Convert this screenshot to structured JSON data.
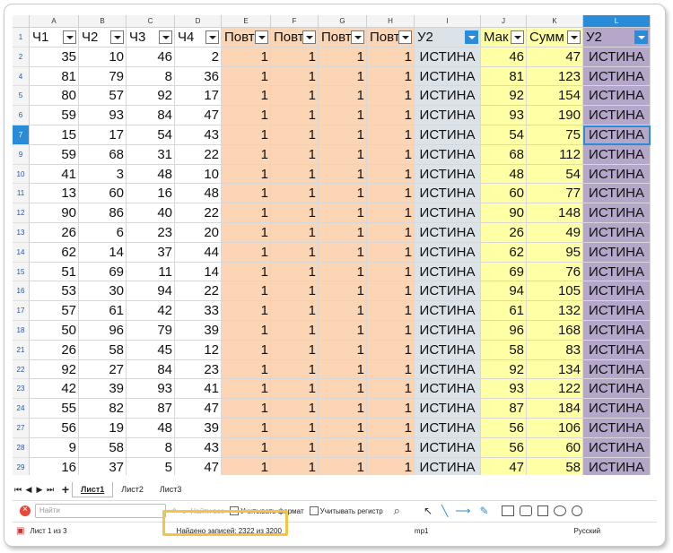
{
  "columns": [
    "A",
    "B",
    "C",
    "D",
    "E",
    "F",
    "G",
    "H",
    "I",
    "J",
    "K",
    "L"
  ],
  "selected_column": "L",
  "header_row": {
    "row_num": "1",
    "cells": [
      "Ч1",
      "Ч2",
      "Ч3",
      "Ч4",
      "Повт",
      "Повт",
      "Повт",
      "Повт",
      "У2",
      "Мак",
      "Сумм",
      "У2"
    ]
  },
  "rows": [
    {
      "num": "2",
      "cells": [
        "35",
        "10",
        "46",
        "2",
        "1",
        "1",
        "1",
        "1",
        "ИСТИНА",
        "46",
        "47",
        "ИСТИНА"
      ]
    },
    {
      "num": "4",
      "cells": [
        "81",
        "79",
        "8",
        "36",
        "1",
        "1",
        "1",
        "1",
        "ИСТИНА",
        "81",
        "123",
        "ИСТИНА"
      ]
    },
    {
      "num": "5",
      "cells": [
        "80",
        "57",
        "92",
        "17",
        "1",
        "1",
        "1",
        "1",
        "ИСТИНА",
        "92",
        "154",
        "ИСТИНА"
      ]
    },
    {
      "num": "6",
      "cells": [
        "59",
        "93",
        "84",
        "47",
        "1",
        "1",
        "1",
        "1",
        "ИСТИНА",
        "93",
        "190",
        "ИСТИНА"
      ]
    },
    {
      "num": "7",
      "cells": [
        "15",
        "17",
        "54",
        "43",
        "1",
        "1",
        "1",
        "1",
        "ИСТИНА",
        "54",
        "75",
        "ИСТИНА"
      ]
    },
    {
      "num": "9",
      "cells": [
        "59",
        "68",
        "31",
        "22",
        "1",
        "1",
        "1",
        "1",
        "ИСТИНА",
        "68",
        "112",
        "ИСТИНА"
      ]
    },
    {
      "num": "10",
      "cells": [
        "41",
        "3",
        "48",
        "10",
        "1",
        "1",
        "1",
        "1",
        "ИСТИНА",
        "48",
        "54",
        "ИСТИНА"
      ]
    },
    {
      "num": "11",
      "cells": [
        "13",
        "60",
        "16",
        "48",
        "1",
        "1",
        "1",
        "1",
        "ИСТИНА",
        "60",
        "77",
        "ИСТИНА"
      ]
    },
    {
      "num": "12",
      "cells": [
        "90",
        "86",
        "40",
        "22",
        "1",
        "1",
        "1",
        "1",
        "ИСТИНА",
        "90",
        "148",
        "ИСТИНА"
      ]
    },
    {
      "num": "13",
      "cells": [
        "26",
        "6",
        "23",
        "20",
        "1",
        "1",
        "1",
        "1",
        "ИСТИНА",
        "26",
        "49",
        "ИСТИНА"
      ]
    },
    {
      "num": "14",
      "cells": [
        "62",
        "14",
        "37",
        "44",
        "1",
        "1",
        "1",
        "1",
        "ИСТИНА",
        "62",
        "95",
        "ИСТИНА"
      ]
    },
    {
      "num": "15",
      "cells": [
        "51",
        "69",
        "11",
        "14",
        "1",
        "1",
        "1",
        "1",
        "ИСТИНА",
        "69",
        "76",
        "ИСТИНА"
      ]
    },
    {
      "num": "16",
      "cells": [
        "53",
        "30",
        "94",
        "22",
        "1",
        "1",
        "1",
        "1",
        "ИСТИНА",
        "94",
        "105",
        "ИСТИНА"
      ]
    },
    {
      "num": "17",
      "cells": [
        "57",
        "61",
        "42",
        "33",
        "1",
        "1",
        "1",
        "1",
        "ИСТИНА",
        "61",
        "132",
        "ИСТИНА"
      ]
    },
    {
      "num": "18",
      "cells": [
        "50",
        "96",
        "79",
        "39",
        "1",
        "1",
        "1",
        "1",
        "ИСТИНА",
        "96",
        "168",
        "ИСТИНА"
      ]
    },
    {
      "num": "21",
      "cells": [
        "26",
        "58",
        "45",
        "12",
        "1",
        "1",
        "1",
        "1",
        "ИСТИНА",
        "58",
        "83",
        "ИСТИНА"
      ]
    },
    {
      "num": "22",
      "cells": [
        "92",
        "27",
        "84",
        "23",
        "1",
        "1",
        "1",
        "1",
        "ИСТИНА",
        "92",
        "134",
        "ИСТИНА"
      ]
    },
    {
      "num": "23",
      "cells": [
        "42",
        "39",
        "93",
        "41",
        "1",
        "1",
        "1",
        "1",
        "ИСТИНА",
        "93",
        "122",
        "ИСТИНА"
      ]
    },
    {
      "num": "24",
      "cells": [
        "55",
        "82",
        "87",
        "47",
        "1",
        "1",
        "1",
        "1",
        "ИСТИНА",
        "87",
        "184",
        "ИСТИНА"
      ]
    },
    {
      "num": "27",
      "cells": [
        "56",
        "19",
        "48",
        "39",
        "1",
        "1",
        "1",
        "1",
        "ИСТИНА",
        "56",
        "106",
        "ИСТИНА"
      ]
    },
    {
      "num": "28",
      "cells": [
        "9",
        "58",
        "8",
        "43",
        "1",
        "1",
        "1",
        "1",
        "ИСТИНА",
        "56",
        "60",
        "ИСТИНА"
      ]
    },
    {
      "num": "29",
      "cells": [
        "16",
        "37",
        "5",
        "47",
        "1",
        "1",
        "1",
        "1",
        "ИСТИНА",
        "47",
        "58",
        "ИСТИНА"
      ]
    }
  ],
  "selected_row": "7",
  "sheet_tabs": [
    "Лист1",
    "Лист2",
    "Лист3"
  ],
  "active_sheet": "Лист1",
  "find": {
    "placeholder": "Найти",
    "find_all": "Найти все",
    "match_format": "Учитывать формат",
    "match_case": "Учитывать регистр"
  },
  "status": {
    "sheet": "Лист 1 из 3",
    "found": "Найдено записей: 2322 из 3200",
    "style": "mp1",
    "language": "Русский"
  },
  "colors": {
    "orange": "#fcd5b5",
    "grey": "#dce3e8",
    "yellow": "#ffffa6",
    "purple": "#b4a7c9",
    "accent": "#2a8bd8"
  }
}
